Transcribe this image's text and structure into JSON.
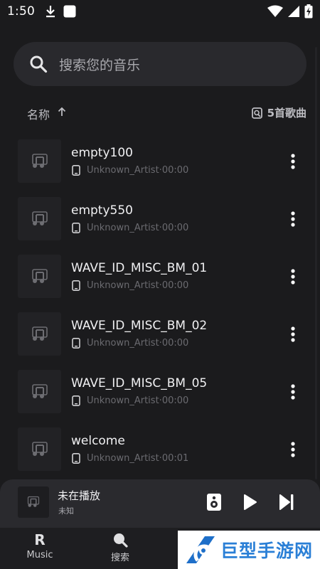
{
  "status_bar": {
    "time": "1:50"
  },
  "search": {
    "placeholder": "搜索您的音乐"
  },
  "sort": {
    "label": "名称",
    "count": "5首歌曲"
  },
  "songs": [
    {
      "title": "empty100",
      "artist": "Unknown_Artist",
      "duration": "00:00"
    },
    {
      "title": "empty550",
      "artist": "Unknown_Artist",
      "duration": "00:00"
    },
    {
      "title": "WAVE_ID_MISC_BM_01",
      "artist": "Unknown_Artist",
      "duration": "00:00"
    },
    {
      "title": "WAVE_ID_MISC_BM_02",
      "artist": "Unknown_Artist",
      "duration": "00:00"
    },
    {
      "title": "WAVE_ID_MISC_BM_05",
      "artist": "Unknown_Artist",
      "duration": "00:00"
    },
    {
      "title": "welcome",
      "artist": "Unknown_Artist",
      "duration": "00:01"
    }
  ],
  "meta_separator": "·",
  "mini_player": {
    "title": "未在播放",
    "subtitle": "未知"
  },
  "bottom_nav": {
    "tabs": [
      {
        "label": "Music",
        "glyph": "R"
      },
      {
        "label": "搜索"
      }
    ]
  },
  "watermark": {
    "text": "巨型手游网"
  },
  "colors": {
    "background": "#1b1b1d",
    "surface": "#29292d",
    "watermark_blue": "#2a7fd6"
  }
}
